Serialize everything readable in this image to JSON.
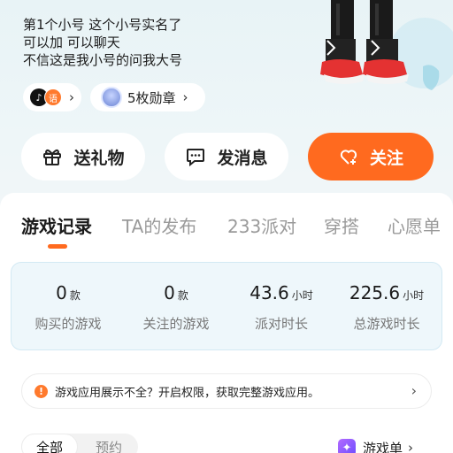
{
  "profile": {
    "bio_lines": [
      "第1个小号  这个小号实名了",
      "可以加  可以聊天",
      "不信这是我小号的问我大号"
    ],
    "badge_count_label": "5枚勋章"
  },
  "actions": {
    "gift": "送礼物",
    "message": "发消息",
    "follow": "关注"
  },
  "tabs": [
    "游戏记录",
    "TA的发布",
    "233派对",
    "穿搭",
    "心愿单"
  ],
  "active_tab": "游戏记录",
  "stats": [
    {
      "value": "0",
      "unit": "款",
      "label": "购买的游戏"
    },
    {
      "value": "0",
      "unit": "款",
      "label": "关注的游戏"
    },
    {
      "value": "43.6",
      "unit": "小时",
      "label": "派对时长"
    },
    {
      "value": "225.6",
      "unit": "小时",
      "label": "总游戏时长"
    }
  ],
  "notice": {
    "icon": "!",
    "text": "游戏应用展示不全？开启权限，获取完整游戏应用。"
  },
  "filters": [
    "全部",
    "预约"
  ],
  "game_list_label": "游戏单",
  "colors": {
    "accent": "#ff6a1f",
    "stats_bg": "#eef7fb"
  }
}
